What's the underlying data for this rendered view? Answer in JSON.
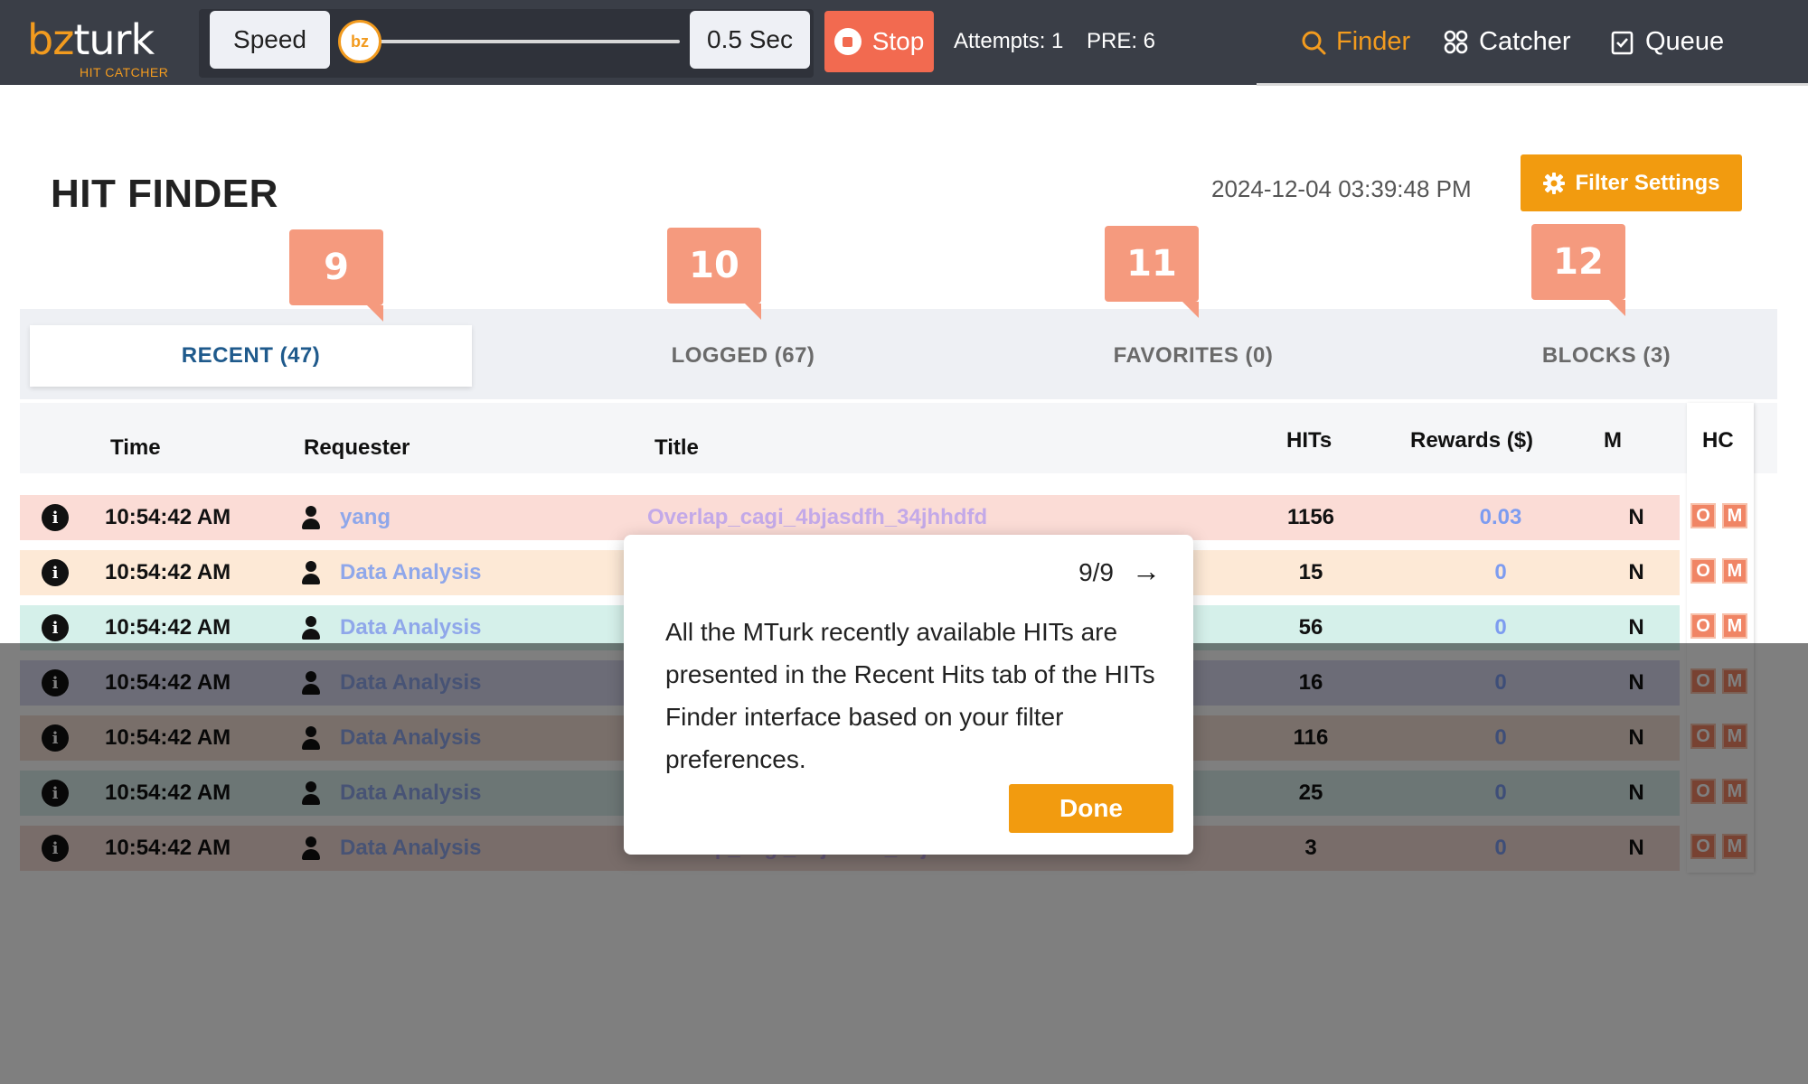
{
  "app": {
    "logo_prefix": "bz",
    "logo_suffix": "turk",
    "logo_subtitle": "HIT CATCHER"
  },
  "toolbar": {
    "speed_label": "Speed",
    "slider_thumb_label": "bz",
    "interval_label": "0.5 Sec",
    "stop_label": "Stop",
    "attempts": "Attempts: 1",
    "pre": "PRE: 6"
  },
  "nav": {
    "finder": "Finder",
    "catcher": "Catcher",
    "queue": "Queue"
  },
  "header": {
    "title": "HIT FINDER",
    "timestamp": "2024-12-04 03:39:48 PM",
    "filter_button": "Filter Settings"
  },
  "tabs": [
    {
      "label": "RECENT (47)",
      "badge": "9"
    },
    {
      "label": "LOGGED (67)",
      "badge": "10"
    },
    {
      "label": "FAVORITES (0)",
      "badge": "11"
    },
    {
      "label": "BLOCKS (3)",
      "badge": "12"
    }
  ],
  "table": {
    "columns": {
      "time": "Time",
      "requester": "Requester",
      "title": "Title",
      "hits": "HITs",
      "rewards": "Rewards ($)",
      "m": "M",
      "hc": "HC"
    },
    "rows": [
      {
        "time": "10:54:42 AM",
        "requester": "yang",
        "title": "Overlap_cagi_4bjasdfh_34jhhdfd",
        "hits": "1156",
        "reward": "0.03",
        "m": "N",
        "btn_o": "O",
        "btn_m": "M",
        "bg": "#fbdcd6"
      },
      {
        "time": "10:54:42 AM",
        "requester": "Data Analysis",
        "title": "",
        "hits": "15",
        "reward": "0",
        "m": "N",
        "btn_o": "O",
        "btn_m": "M",
        "bg": "#fde9d6"
      },
      {
        "time": "10:54:42 AM",
        "requester": "Data Analysis",
        "title": "",
        "hits": "56",
        "reward": "0",
        "m": "N",
        "btn_o": "O",
        "btn_m": "M",
        "bg": "#d5f0ea"
      },
      {
        "time": "10:54:42 AM",
        "requester": "Data Analysis",
        "title": "",
        "hits": "16",
        "reward": "0",
        "m": "N",
        "btn_o": "O",
        "btn_m": "M",
        "bg": "#d8d8ee"
      },
      {
        "time": "10:54:42 AM",
        "requester": "Data Analysis",
        "title": "",
        "hits": "116",
        "reward": "0",
        "m": "N",
        "btn_o": "O",
        "btn_m": "M",
        "bg": "#f2dfd4"
      },
      {
        "time": "10:54:42 AM",
        "requester": "Data Analysis",
        "title": "",
        "hits": "25",
        "reward": "0",
        "m": "N",
        "btn_o": "O",
        "btn_m": "M",
        "bg": "#d8ecea"
      },
      {
        "time": "10:54:42 AM",
        "requester": "Data Analysis",
        "title": "Overlap_cagi_4bjasdfh_34jhhdfd",
        "hits": "3",
        "reward": "0",
        "m": "N",
        "btn_o": "O",
        "btn_m": "M",
        "bg": "#f2dad4"
      }
    ]
  },
  "tour": {
    "counter": "9/9",
    "arrow": "→",
    "body": "All the MTurk recently available HITs are presented in the Recent Hits tab of the HITs Finder interface based on your filter preferences.",
    "done_label": "Done"
  },
  "colors": {
    "topbar": "#3a3e47",
    "accent": "#f29b1f",
    "stop": "#f26a50",
    "badge": "#f59a7e",
    "active_tab_text": "#1f5a8c"
  }
}
